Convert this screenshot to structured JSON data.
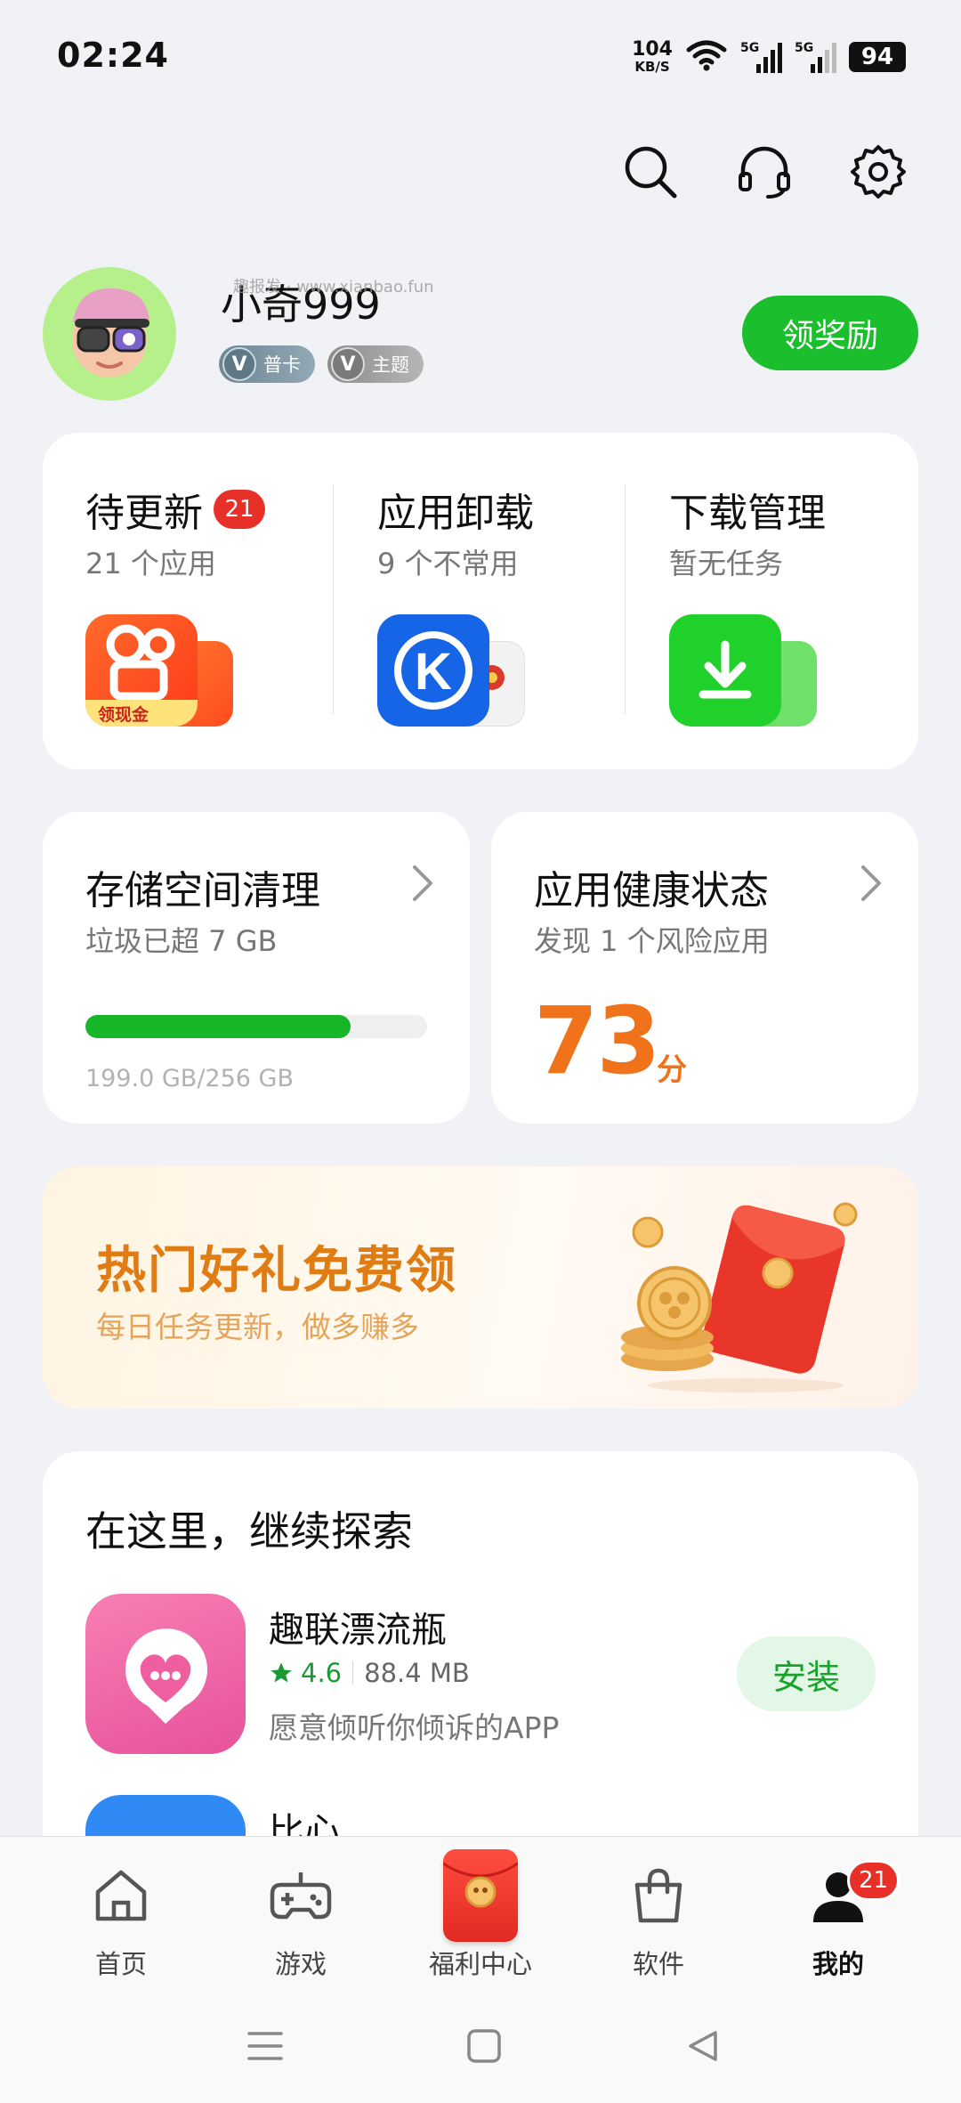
{
  "status_bar": {
    "time": "02:24",
    "net_speed_value": "104",
    "net_speed_unit": "KB/S",
    "signal1_label": "5G",
    "signal2_label": "5G",
    "battery": "94"
  },
  "profile": {
    "username": "小奇999",
    "watermark": "趣报发 · www.xianbao.fun",
    "badge_card": "普卡",
    "badge_theme": "主题",
    "reward_button": "领奖励"
  },
  "quick_actions": [
    {
      "title": "待更新",
      "badge": "21",
      "subtitle": "21 个应用"
    },
    {
      "title": "应用卸载",
      "subtitle": "9 个不常用"
    },
    {
      "title": "下载管理",
      "subtitle": "暂无任务"
    }
  ],
  "kuaishou_icon_caption": "领现金",
  "storage": {
    "title": "存储空间清理",
    "subtitle": "垃圾已超 7 GB",
    "usage_text": "199.0 GB/256 GB",
    "used_fraction": 0.777
  },
  "health": {
    "title": "应用健康状态",
    "subtitle": "发现 1 个风险应用",
    "score": "73",
    "score_unit": "分"
  },
  "banner": {
    "title": "热门好礼免费领",
    "subtitle": "每日任务更新，做多赚多"
  },
  "explore": {
    "title": "在这里，继续探索",
    "apps": [
      {
        "name": "趣联漂流瓶",
        "rating": "4.6",
        "size": "88.4 MB",
        "description": "愿意倾听你倾诉的APP",
        "install_label": "安装"
      },
      {
        "name": "比心"
      }
    ]
  },
  "bottom_nav": [
    {
      "label": "首页"
    },
    {
      "label": "游戏"
    },
    {
      "label": "福利中心"
    },
    {
      "label": "软件"
    },
    {
      "label": "我的",
      "badge": "21"
    }
  ],
  "colors": {
    "brand_green": "#1bbf2d",
    "accent_orange": "#f0731b",
    "badge_red": "#e73128"
  }
}
